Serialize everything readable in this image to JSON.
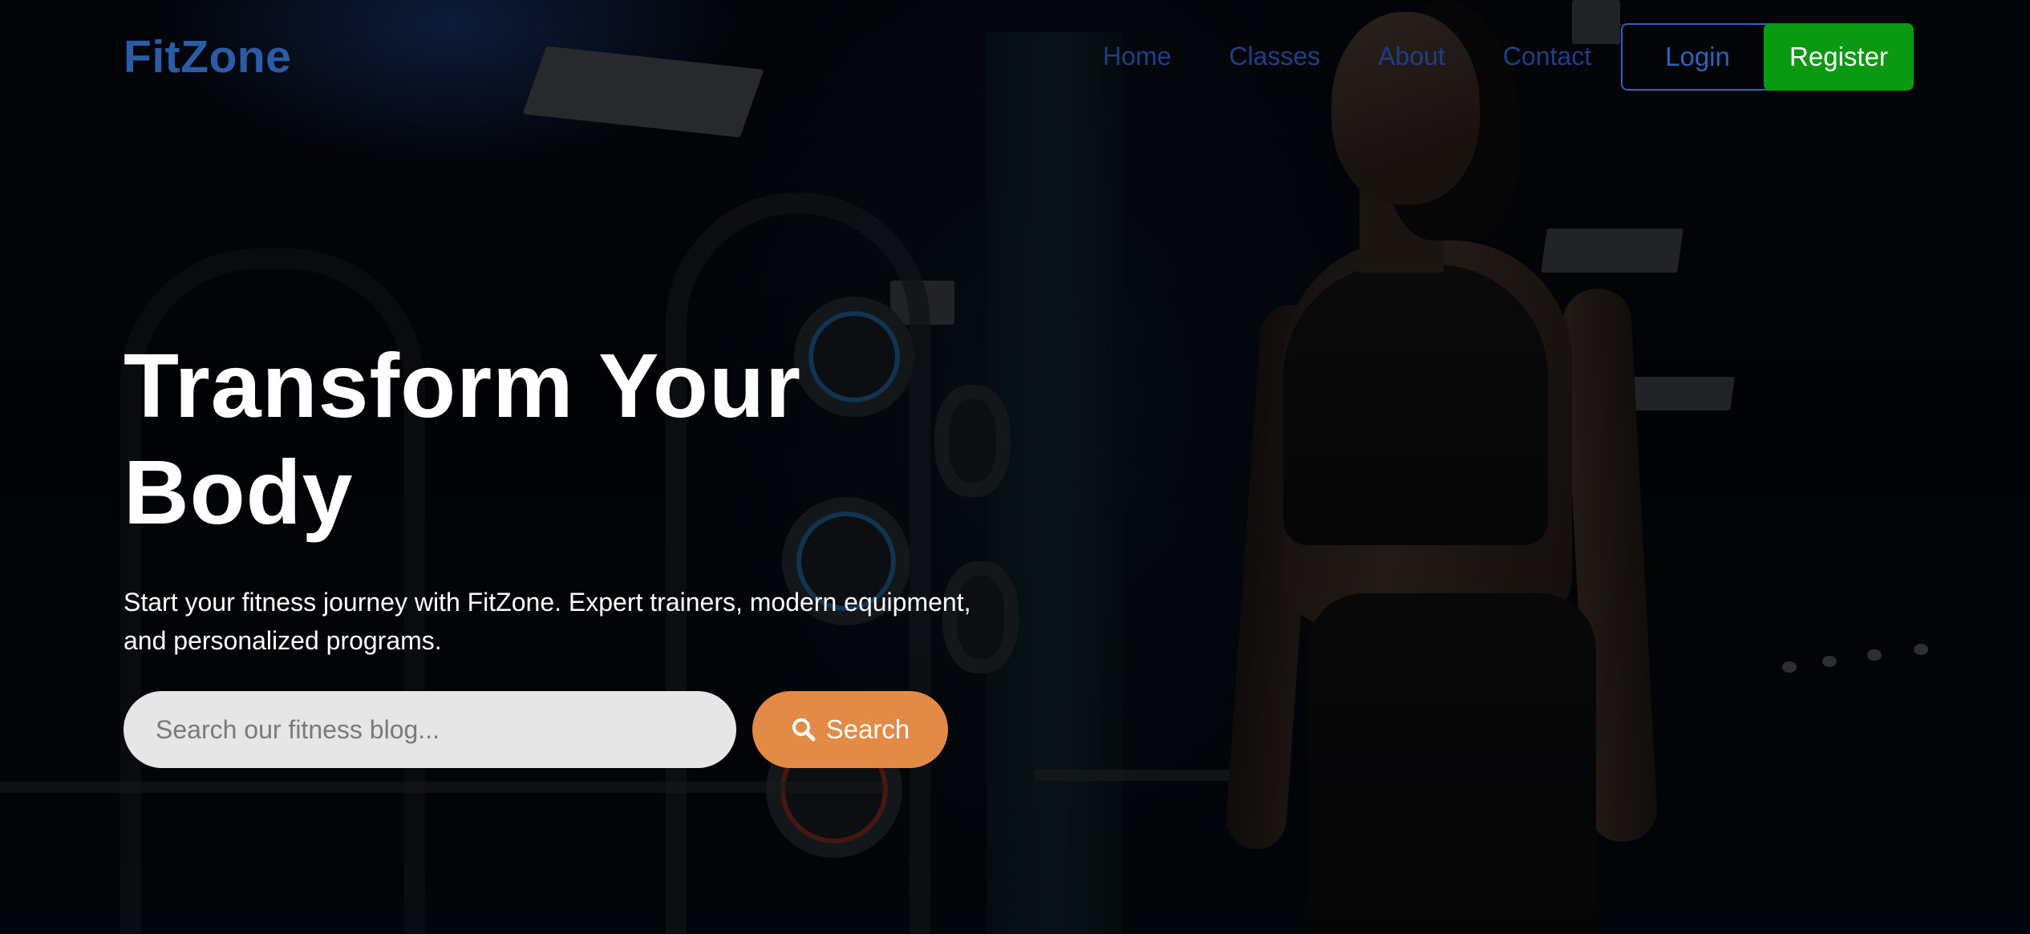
{
  "brand": {
    "logo_text": "FitZone",
    "logo_color": "#2a5ca8"
  },
  "nav": {
    "links": [
      {
        "label": "Home"
      },
      {
        "label": "Classes"
      },
      {
        "label": "About"
      },
      {
        "label": "Contact"
      }
    ],
    "login_label": "Login",
    "register_label": "Register",
    "register_color": "#0a9a12"
  },
  "hero": {
    "title_line1": "Transform Your",
    "title_line2": "Body",
    "subtitle_line1": "Start your fitness journey with FitZone. Expert trainers, modern equipment,",
    "subtitle_line2": "and personalized programs."
  },
  "search": {
    "placeholder": "Search our fitness blog...",
    "value": "",
    "button_label": "Search",
    "button_icon": "search-icon",
    "button_color": "#e38b46"
  }
}
